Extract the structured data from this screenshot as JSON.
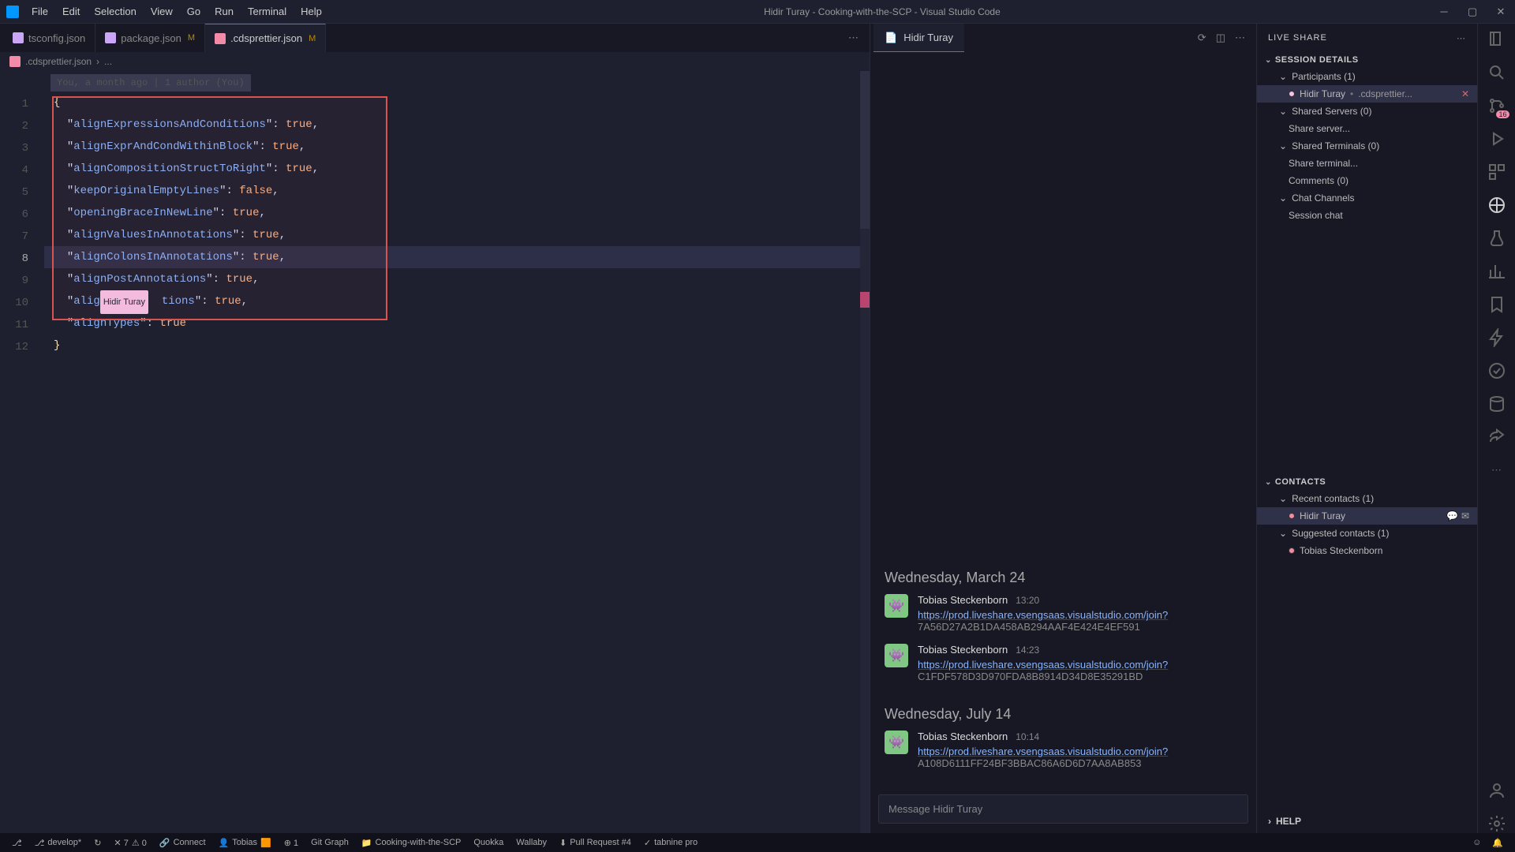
{
  "menus": [
    "File",
    "Edit",
    "Selection",
    "View",
    "Go",
    "Run",
    "Terminal",
    "Help"
  ],
  "window_title": "Hidir Turay - Cooking-with-the-SCP - Visual Studio Code",
  "tabs": [
    {
      "name": "tsconfig.json",
      "mod": false,
      "active": false,
      "iconcls": "js"
    },
    {
      "name": "package.json",
      "mod": true,
      "active": false,
      "iconcls": "js"
    },
    {
      "name": ".cdsprettier.json",
      "mod": true,
      "active": true,
      "iconcls": ""
    }
  ],
  "breadcrumb": {
    "file": ".cdsprettier.json",
    "rest": "..."
  },
  "blame": "You, a month ago | 1 author (You)",
  "code_lines": [
    {
      "n": 1,
      "text": "{",
      "type": "brace"
    },
    {
      "n": 2,
      "key": "alignExpressionsAndConditions",
      "val": "true"
    },
    {
      "n": 3,
      "key": "alignExprAndCondWithinBlock",
      "val": "true"
    },
    {
      "n": 4,
      "key": "alignCompositionStructToRight",
      "val": "true"
    },
    {
      "n": 5,
      "key": "keepOriginalEmptyLines",
      "val": "false"
    },
    {
      "n": 6,
      "key": "openingBraceInNewLine",
      "val": "true"
    },
    {
      "n": 7,
      "key": "alignValuesInAnnotations",
      "val": "true"
    },
    {
      "n": 8,
      "key": "alignColonsInAnnotations",
      "val": "true",
      "cur": true
    },
    {
      "n": 9,
      "key": "alignPostAnnotations",
      "val": "true"
    },
    {
      "n": 10,
      "key_a": "alig",
      "collab": "Hidir Turay",
      "key_b": "tions",
      "val": "true"
    },
    {
      "n": 11,
      "key": "alignTypes",
      "val": "true",
      "last": true
    },
    {
      "n": 12,
      "text": "}",
      "type": "brace"
    }
  ],
  "chat": {
    "tab_title": "Hidir Turay",
    "dates": [
      {
        "label": "Wednesday, March 24",
        "msgs": [
          {
            "name": "Tobias Steckenborn",
            "time": "13:20",
            "link": "https://prod.liveshare.vsengsaas.visualstudio.com/join?",
            "hash": "7A56D27A2B1DA458AB294AAF4E424E4EF591"
          },
          {
            "name": "Tobias Steckenborn",
            "time": "14:23",
            "link": "https://prod.liveshare.vsengsaas.visualstudio.com/join?",
            "hash": "C1FDF578D3D970FDA8B8914D34D8E35291BD"
          }
        ]
      },
      {
        "label": "Wednesday, July 14",
        "msgs": [
          {
            "name": "Tobias Steckenborn",
            "time": "10:14",
            "link": "https://prod.liveshare.vsengsaas.visualstudio.com/join?",
            "hash": "A108D6111FF24BF3BBAC86A6D6D7AA8AB853"
          }
        ]
      }
    ],
    "input_placeholder": "Message Hidir Turay"
  },
  "liveshare": {
    "title": "LIVE SHARE",
    "session_details": "SESSION DETAILS",
    "participants": "Participants (1)",
    "participant_item": {
      "name": "Hidir Turay",
      "file": ".cdsprettier...",
      "closable": true
    },
    "shared_servers": "Shared Servers (0)",
    "share_server": "Share server...",
    "shared_terminals": "Shared Terminals (0)",
    "share_terminal": "Share terminal...",
    "comments": "Comments (0)",
    "chat_channels": "Chat Channels",
    "session_chat": "Session chat",
    "contacts": "CONTACTS",
    "recent_contacts": "Recent contacts (1)",
    "recent_item": "Hidir Turay",
    "suggested_contacts": "Suggested contacts (1)",
    "suggested_item": "Tobias Steckenborn",
    "help": "HELP"
  },
  "statusbar": {
    "branch": "develop*",
    "sync": "↻",
    "errors": "✕ 7",
    "warnings": "⚠ 0",
    "connect": "Connect",
    "tobias": "Tobias",
    "tobias_badge": "🟧",
    "count": "⊕ 1",
    "gitgraph": "Git Graph",
    "cook": "Cooking-with-the-SCP",
    "quokka": "Quokka",
    "wallaby": "Wallaby",
    "pr": "Pull Request #4",
    "tabnine": "tabnine pro",
    "bell": "🔔"
  },
  "activity_badge": "16"
}
